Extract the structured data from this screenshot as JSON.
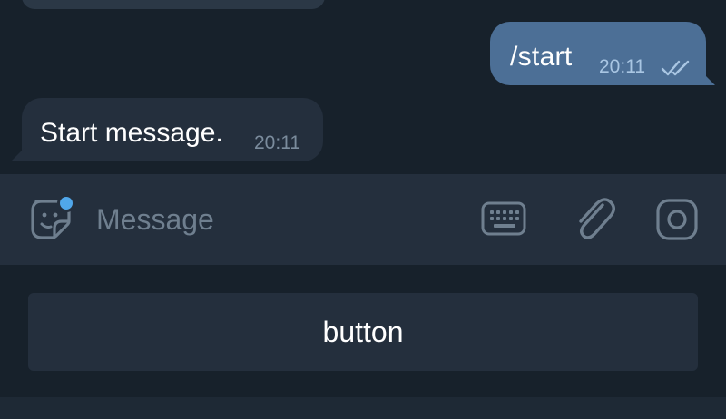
{
  "chat": {
    "messages": [
      {
        "direction": "outgoing",
        "text": "/start",
        "time": "20:11",
        "status": "read"
      },
      {
        "direction": "incoming",
        "text": "Start message.",
        "time": "20:11"
      }
    ]
  },
  "composer": {
    "placeholder": "Message",
    "icons": [
      "sticker-icon",
      "keyboard-icon",
      "paperclip-icon",
      "camera-icon"
    ],
    "has_notification_dot": true
  },
  "bot_keyboard": {
    "buttons": [
      {
        "label": "button"
      }
    ]
  },
  "colors": {
    "background": "#17212b",
    "panel": "#242f3d",
    "outgoing_bubble": "#4c6f96",
    "accent": "#50a7ea",
    "muted_text": "#7b8c9d"
  }
}
